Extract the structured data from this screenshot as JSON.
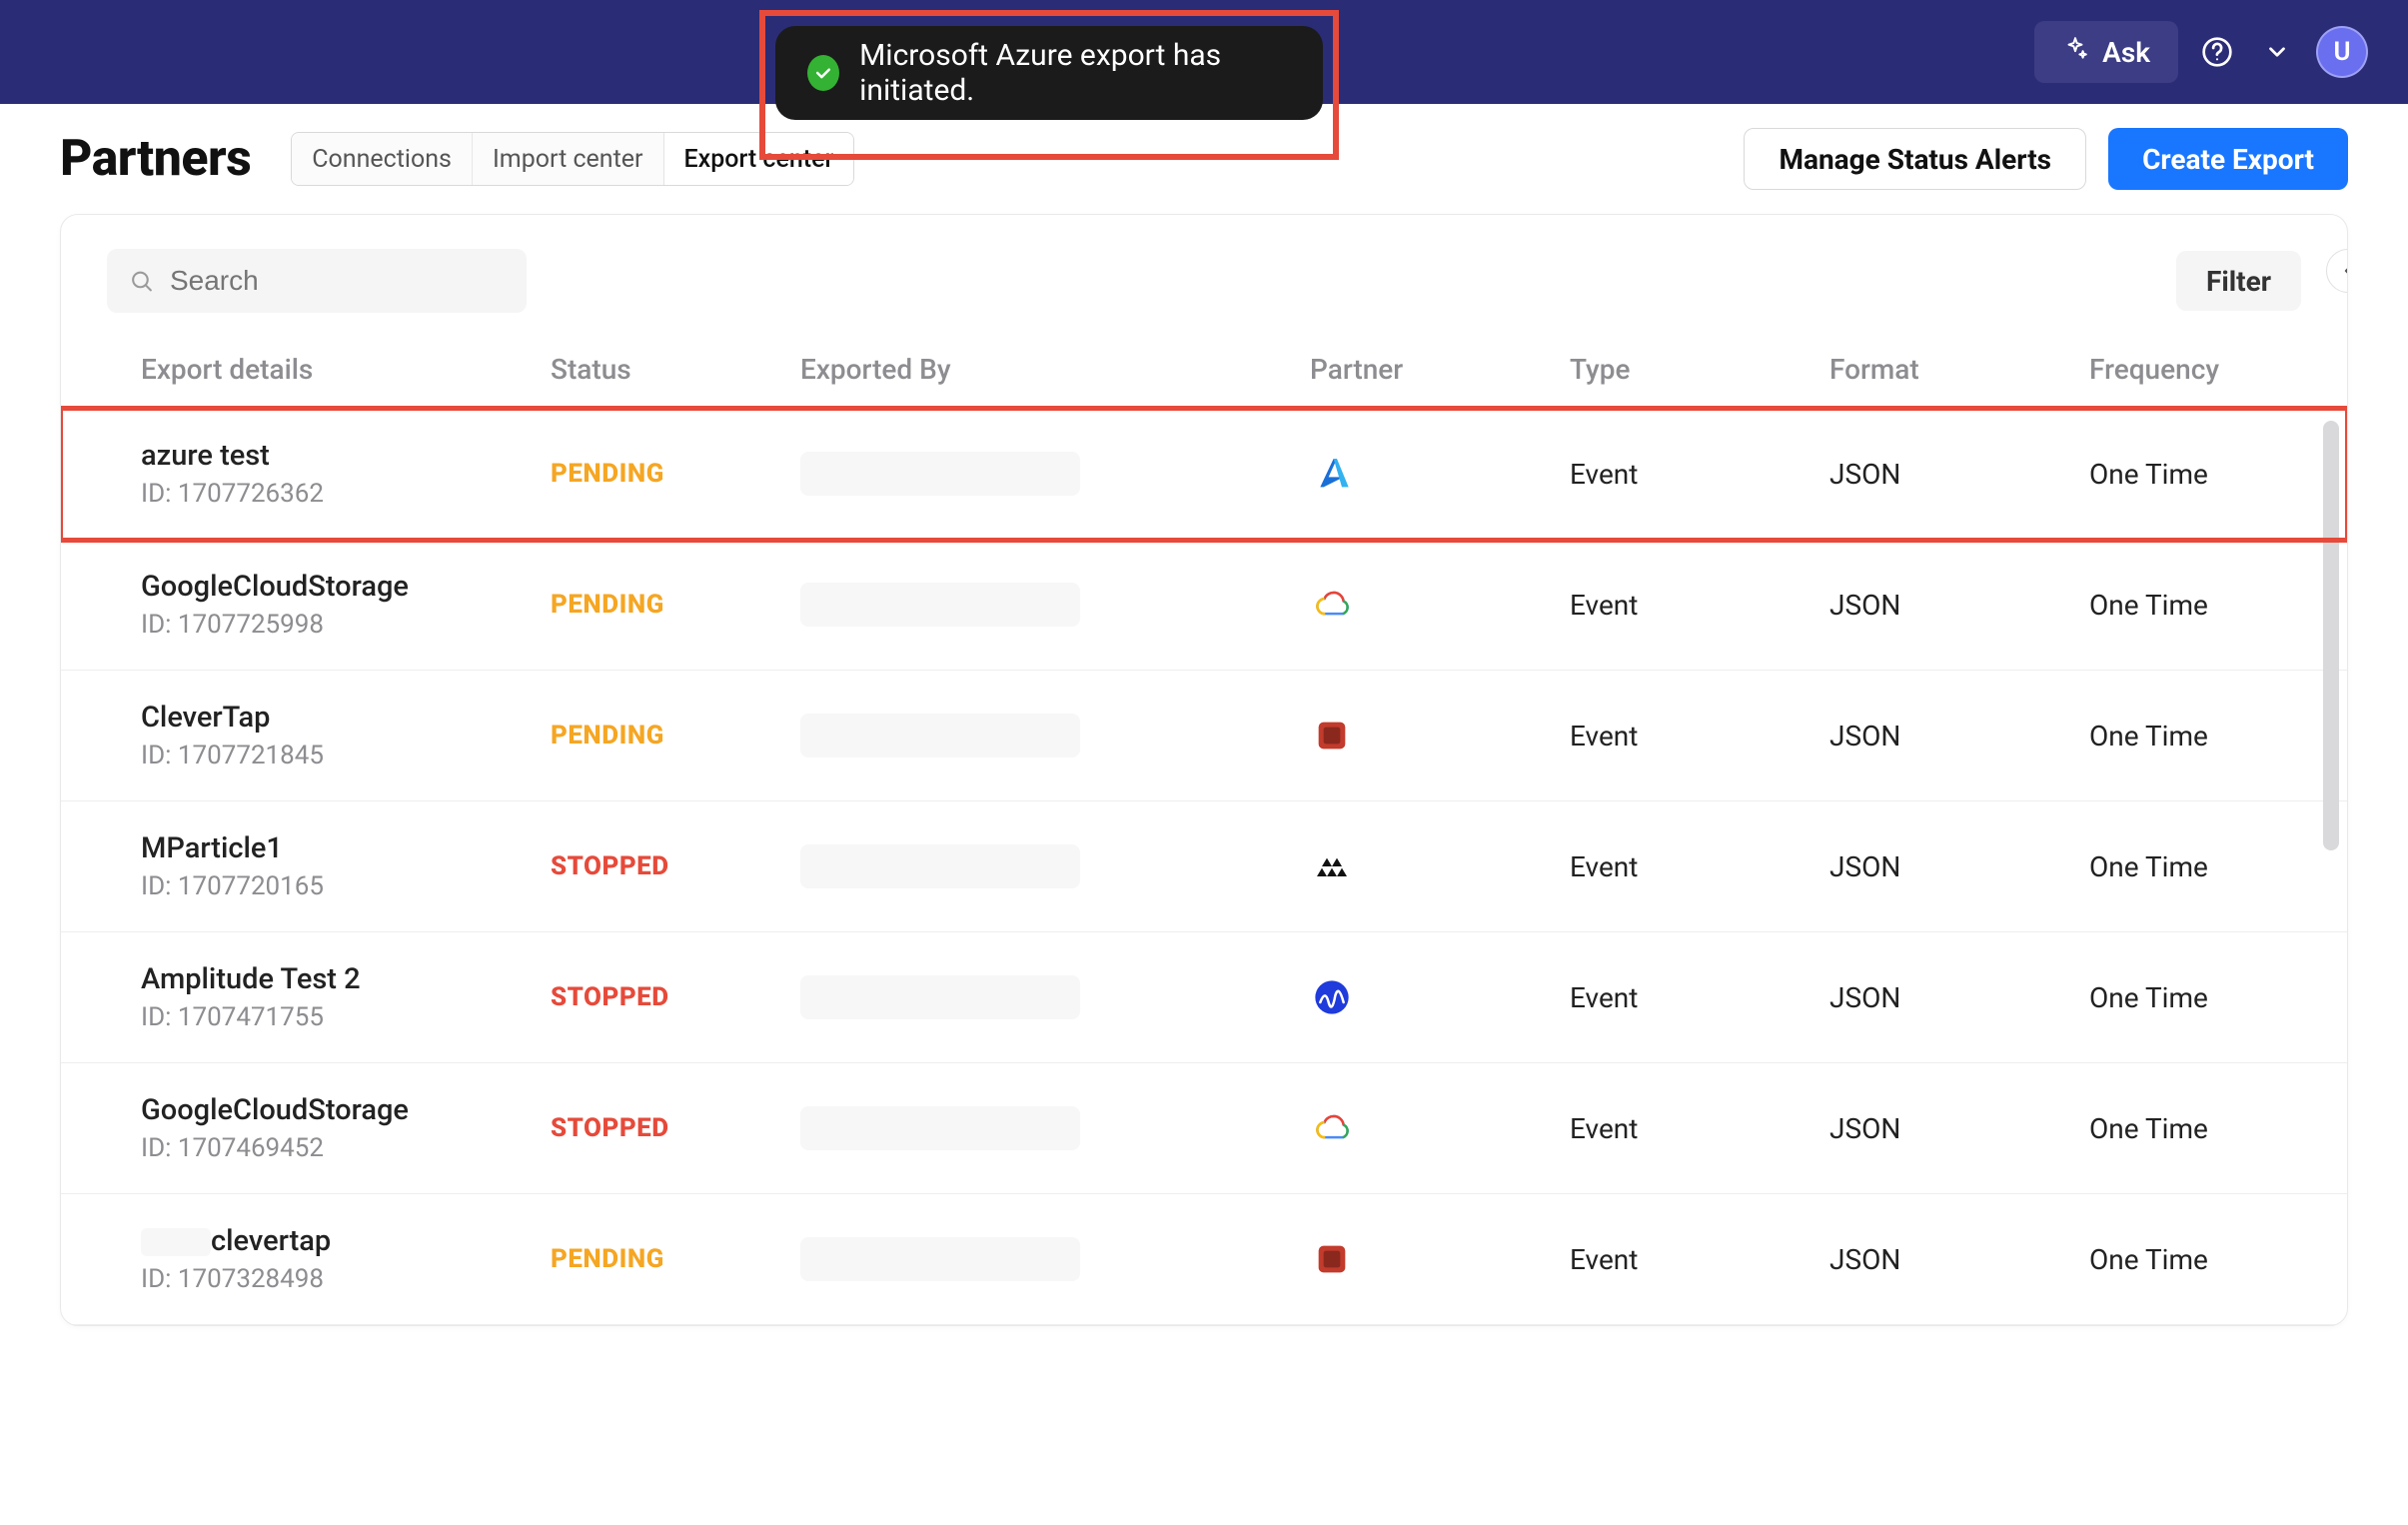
{
  "colors": {
    "navy": "#2b2c76",
    "primary": "#1976ff",
    "pending": "#f5a623",
    "stopped": "#e64a3a",
    "highlight": "#e64a3a"
  },
  "topnav": {
    "ask_label": "Ask",
    "avatar_initial": "U"
  },
  "toast": {
    "message": "Microsoft Azure export has initiated."
  },
  "header": {
    "title": "Partners",
    "tabs": [
      {
        "label": "Connections",
        "active": false
      },
      {
        "label": "Import center",
        "active": false
      },
      {
        "label": "Export center",
        "active": true
      }
    ],
    "manage_alerts_label": "Manage Status Alerts",
    "create_export_label": "Create Export"
  },
  "toolbar": {
    "search_placeholder": "Search",
    "filter_label": "Filter"
  },
  "table": {
    "columns": {
      "export_details": "Export details",
      "status": "Status",
      "exported_by": "Exported By",
      "partner": "Partner",
      "type": "Type",
      "format": "Format",
      "frequency": "Frequency"
    },
    "id_prefix": "ID: ",
    "rows": [
      {
        "name": "azure test",
        "id": "1707726362",
        "status": "PENDING",
        "partner": "azure",
        "type": "Event",
        "format": "JSON",
        "frequency": "One Time",
        "highlight": true,
        "name_prefix_redacted": false
      },
      {
        "name": "GoogleCloudStorage",
        "id": "1707725998",
        "status": "PENDING",
        "partner": "gcs",
        "type": "Event",
        "format": "JSON",
        "frequency": "One Time",
        "highlight": false,
        "name_prefix_redacted": false
      },
      {
        "name": "CleverTap",
        "id": "1707721845",
        "status": "PENDING",
        "partner": "clevertap",
        "type": "Event",
        "format": "JSON",
        "frequency": "One Time",
        "highlight": false,
        "name_prefix_redacted": false
      },
      {
        "name": "MParticle1",
        "id": "1707720165",
        "status": "STOPPED",
        "partner": "mparticle",
        "type": "Event",
        "format": "JSON",
        "frequency": "One Time",
        "highlight": false,
        "name_prefix_redacted": false
      },
      {
        "name": "Amplitude Test 2",
        "id": "1707471755",
        "status": "STOPPED",
        "partner": "amplitude",
        "type": "Event",
        "format": "JSON",
        "frequency": "One Time",
        "highlight": false,
        "name_prefix_redacted": false
      },
      {
        "name": "GoogleCloudStorage",
        "id": "1707469452",
        "status": "STOPPED",
        "partner": "gcs",
        "type": "Event",
        "format": "JSON",
        "frequency": "One Time",
        "highlight": false,
        "name_prefix_redacted": false
      },
      {
        "name": "clevertap",
        "id": "1707328498",
        "status": "PENDING",
        "partner": "clevertap",
        "type": "Event",
        "format": "JSON",
        "frequency": "One Time",
        "highlight": false,
        "name_prefix_redacted": true
      }
    ]
  }
}
